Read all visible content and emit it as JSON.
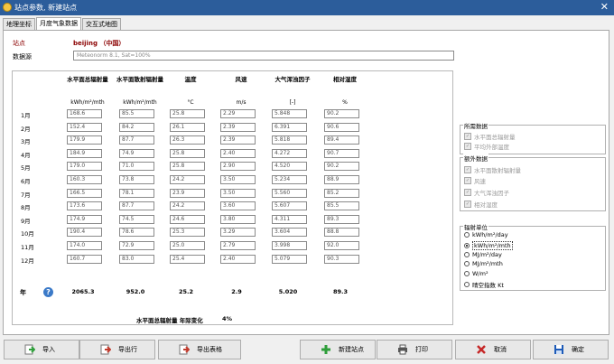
{
  "window": {
    "title": "站点参数, 新建站点",
    "close_glyph": "✕"
  },
  "tabs": [
    {
      "label": "地理坐标",
      "active": false
    },
    {
      "label": "月度气象数据",
      "active": true
    },
    {
      "label": "交互式地图",
      "active": false
    }
  ],
  "site": {
    "label": "站点",
    "value": "beijing （中国）"
  },
  "database": {
    "label": "数据源",
    "value": "Meteonorm 8.1, Sat=100%"
  },
  "columns": [
    {
      "header": "水平面总辐射量",
      "unit": "kWh/m²/mth",
      "total": "2065.3"
    },
    {
      "header": "水平面散射辐射量",
      "unit": "kWh/m²/mth",
      "total": "952.0"
    },
    {
      "header": "温度",
      "unit": "°C",
      "total": "25.2"
    },
    {
      "header": "风速",
      "unit": "m/s",
      "total": "2.9"
    },
    {
      "header": "大气浑浊因子",
      "unit": "[-]",
      "total": "5.020"
    },
    {
      "header": "相对湿度",
      "unit": "%",
      "total": "89.3"
    }
  ],
  "rows": [
    {
      "month": "1月",
      "values": [
        "168.6",
        "85.5",
        "25.8",
        "2.29",
        "5.848",
        "90.2"
      ]
    },
    {
      "month": "2月",
      "values": [
        "152.4",
        "84.2",
        "26.1",
        "2.39",
        "6.391",
        "90.6"
      ]
    },
    {
      "month": "3月",
      "values": [
        "179.9",
        "87.7",
        "26.3",
        "2.39",
        "5.818",
        "89.4"
      ]
    },
    {
      "month": "4月",
      "values": [
        "184.9",
        "74.9",
        "25.8",
        "2.40",
        "4.272",
        "90.7"
      ]
    },
    {
      "month": "5月",
      "values": [
        "179.0",
        "71.0",
        "25.8",
        "2.90",
        "4.520",
        "90.2"
      ]
    },
    {
      "month": "6月",
      "values": [
        "160.3",
        "73.8",
        "24.2",
        "3.50",
        "5.234",
        "88.9"
      ]
    },
    {
      "month": "7月",
      "values": [
        "166.5",
        "78.1",
        "23.9",
        "3.50",
        "5.560",
        "85.2"
      ]
    },
    {
      "month": "8月",
      "values": [
        "173.6",
        "87.7",
        "24.2",
        "3.60",
        "5.607",
        "85.5"
      ]
    },
    {
      "month": "9月",
      "values": [
        "174.9",
        "74.5",
        "24.6",
        "3.80",
        "4.311",
        "89.3"
      ]
    },
    {
      "month": "10月",
      "values": [
        "190.4",
        "78.6",
        "25.3",
        "3.29",
        "3.604",
        "88.8"
      ]
    },
    {
      "month": "11月",
      "values": [
        "174.0",
        "72.9",
        "25.0",
        "2.79",
        "3.998",
        "92.0"
      ]
    },
    {
      "month": "12月",
      "values": [
        "160.7",
        "83.0",
        "25.4",
        "2.40",
        "5.079",
        "90.3"
      ]
    }
  ],
  "year": {
    "label": "年",
    "help_glyph": "?"
  },
  "variation": {
    "label": "水平面总辐射量 年际变化",
    "value": "4%"
  },
  "required_data": {
    "title": "所需数据",
    "items": [
      "水平面总辐射量",
      "平均外部温度"
    ]
  },
  "extra_data": {
    "title": "额外数据",
    "items": [
      "水平面散射辐射量",
      "风速",
      "大气浑浊因子",
      "相对湿度"
    ]
  },
  "irradiation_units": {
    "title": "辐射单位",
    "options": [
      "kWh/m²/day",
      "kWh/m²/mth",
      "MJ/m²/day",
      "MJ/m²/mth",
      "W/m²",
      "晴空指数 Kt"
    ],
    "selected_index": 1
  },
  "buttons": [
    {
      "label": "导入",
      "icon": "import-icon",
      "color": "#2e9e3a"
    },
    {
      "label": "导出行",
      "icon": "export-row-icon",
      "color": "#c0392b"
    },
    {
      "label": "导出表格",
      "icon": "export-table-icon",
      "color": "#c0392b"
    },
    {
      "label": "新建站点",
      "icon": "plus-icon",
      "color": "#2e9e3a"
    },
    {
      "label": "打印",
      "icon": "printer-icon",
      "color": "#555555"
    },
    {
      "label": "取消",
      "icon": "close-icon",
      "color": "#c62828"
    },
    {
      "label": "确定",
      "icon": "save-icon",
      "color": "#1e5bb8"
    }
  ]
}
